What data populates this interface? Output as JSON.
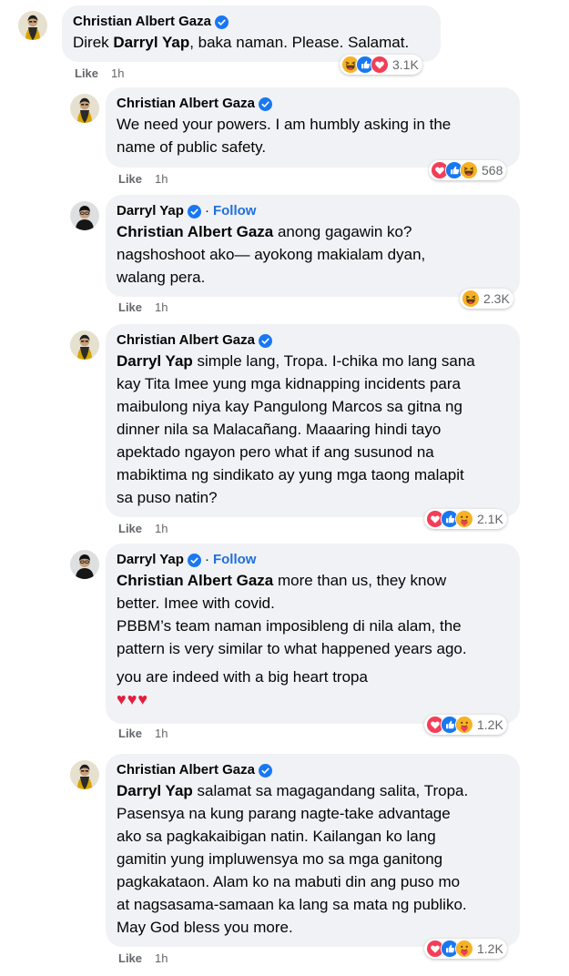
{
  "comments": [
    {
      "author": "Christian Albert Gaza",
      "avatar": "avatar-christian",
      "segments": [
        {
          "bold": "Darryl Yap",
          "prefix": "Direk ",
          "rest": ", baka naman. Please. Salamat."
        }
      ],
      "like_label": "Like",
      "time": "1h",
      "reaction_count": "3.1K",
      "reactions": [
        "haha",
        "like",
        "love"
      ]
    },
    {
      "author": "Christian Albert Gaza",
      "avatar": "avatar-christian",
      "text_lines": [
        "We need your powers. I am humbly asking in the",
        "name of public safety."
      ],
      "like_label": "Like",
      "time": "1h",
      "reaction_count": "568",
      "reactions": [
        "love",
        "like",
        "haha"
      ]
    },
    {
      "author": "Darryl Yap",
      "follow_label": "Follow",
      "dot": "·",
      "mention": "Christian Albert Gaza",
      "first_line_rest": " anong gagawin ko?",
      "text_lines": [
        "nagshoshoot ako— ayokong makialam dyan,",
        "walang pera."
      ],
      "like_label": "Like",
      "time": "1h",
      "reaction_count": "2.3K",
      "reactions": [
        "haha"
      ]
    },
    {
      "author": "Christian Albert Gaza",
      "mention": "Darryl Yap",
      "first_line_rest": " simple lang, Tropa. I-chika mo lang sana",
      "text_lines": [
        "kay Tita Imee yung mga kidnapping incidents para",
        "maibulong niya kay Pangulong Marcos sa gitna ng",
        "dinner nila sa Malacañang. Maaaring hindi tayo",
        "apektado ngayon pero what if ang susunod na",
        "mabiktima ng sindikato ay yung mga taong malapit",
        "sa puso natin?"
      ],
      "like_label": "Like",
      "time": "1h",
      "reaction_count": "2.1K",
      "reactions": [
        "love",
        "like",
        "care"
      ]
    },
    {
      "author": "Darryl Yap",
      "follow_label": "Follow",
      "dot": "·",
      "mention": "Christian Albert Gaza",
      "first_line_rest": " more than us, they know",
      "text_lines": [
        "better. Imee with covid.",
        "PBBM’s team naman imposibleng di nila alam, the",
        "pattern is very similar to what happened years ago."
      ],
      "para2": "you are indeed with a big heart tropa",
      "hearts": "♥♥♥",
      "like_label": "Like",
      "time": "1h",
      "reaction_count": "1.2K",
      "reactions": [
        "love",
        "like",
        "care"
      ]
    },
    {
      "author": "Christian Albert Gaza",
      "mention": "Darryl Yap",
      "first_line_rest": " salamat sa magagandang salita, Tropa.",
      "text_lines": [
        "Pasensya na kung parang nagte-take advantage",
        "ako sa pagkakaibigan natin. Kailangan ko lang",
        "gamitin yung impluwensya mo sa mga ganitong",
        "pagkakataon. Alam ko na mabuti din ang puso mo",
        "at nagsasama-samaan ka lang sa mata ng publiko.",
        "May God bless you more."
      ],
      "like_label": "Like",
      "time": "1h",
      "reaction_count": "1.2K",
      "reactions": [
        "love",
        "like",
        "care"
      ]
    }
  ],
  "colors": {
    "bubble": "#f0f2f5",
    "link": "#216fdb",
    "meta": "#65676b",
    "like": "#1877f2",
    "love": "#f33e58",
    "haha": "#f7b125",
    "heart": "#e41e3f"
  }
}
